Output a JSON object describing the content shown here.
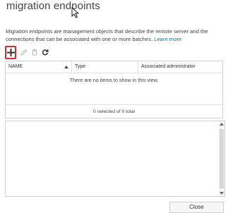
{
  "page": {
    "title": "migration endpoints",
    "description_text": "Migration endpoints are management objects that describe the remote server and the connections that can be associated with one or more batches.",
    "learn_more": "Learn more"
  },
  "toolbar": {
    "add_icon": "plus-icon",
    "edit_icon": "pencil-icon",
    "delete_icon": "trash-icon",
    "refresh_icon": "refresh-icon"
  },
  "grid": {
    "columns": [
      "NAME",
      "Type",
      "Associated administrator"
    ],
    "sort_indicator": "ascending",
    "empty_message": "There are no items to show in this view.",
    "status": "0 selected of 0 total"
  },
  "footer": {
    "close_label": "Close"
  },
  "colors": {
    "link": "#0072c6",
    "highlight_border": "#d12d2d"
  }
}
